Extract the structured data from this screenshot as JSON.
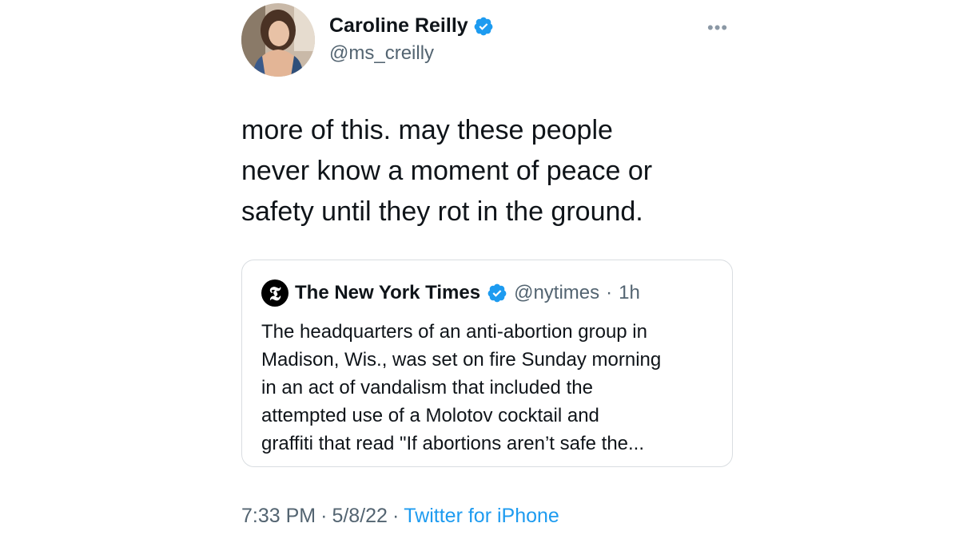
{
  "author": {
    "display_name": "Caroline Reilly",
    "handle": "@ms_creilly",
    "avatar_icon": "profile-photo",
    "verified_icon": "verified-badge-icon"
  },
  "tweet": {
    "text": "more of this. may these people\nnever know a moment of peace or\nsafety until they rot in the ground."
  },
  "quoted_tweet": {
    "display_name": "The New York Times",
    "handle": "@nytimes",
    "dot": "·",
    "age": "1h",
    "logo_glyph": "𝕿",
    "text": "The headquarters of an anti-abortion group in\nMadison, Wis., was set on fire Sunday morning\nin an act of vandalism that included the\nattempted use of a Molotov cocktail and\ngraffiti that read \"If abortions aren’t safe the..."
  },
  "meta": {
    "time": "7:33 PM",
    "sep1": "·",
    "date": "5/8/22",
    "sep2": "·",
    "source": "Twitter for iPhone"
  },
  "more_label": "•••",
  "colors": {
    "verified": "#1d9bf0",
    "link": "#1d9bf0",
    "secondary_text": "#536471"
  }
}
